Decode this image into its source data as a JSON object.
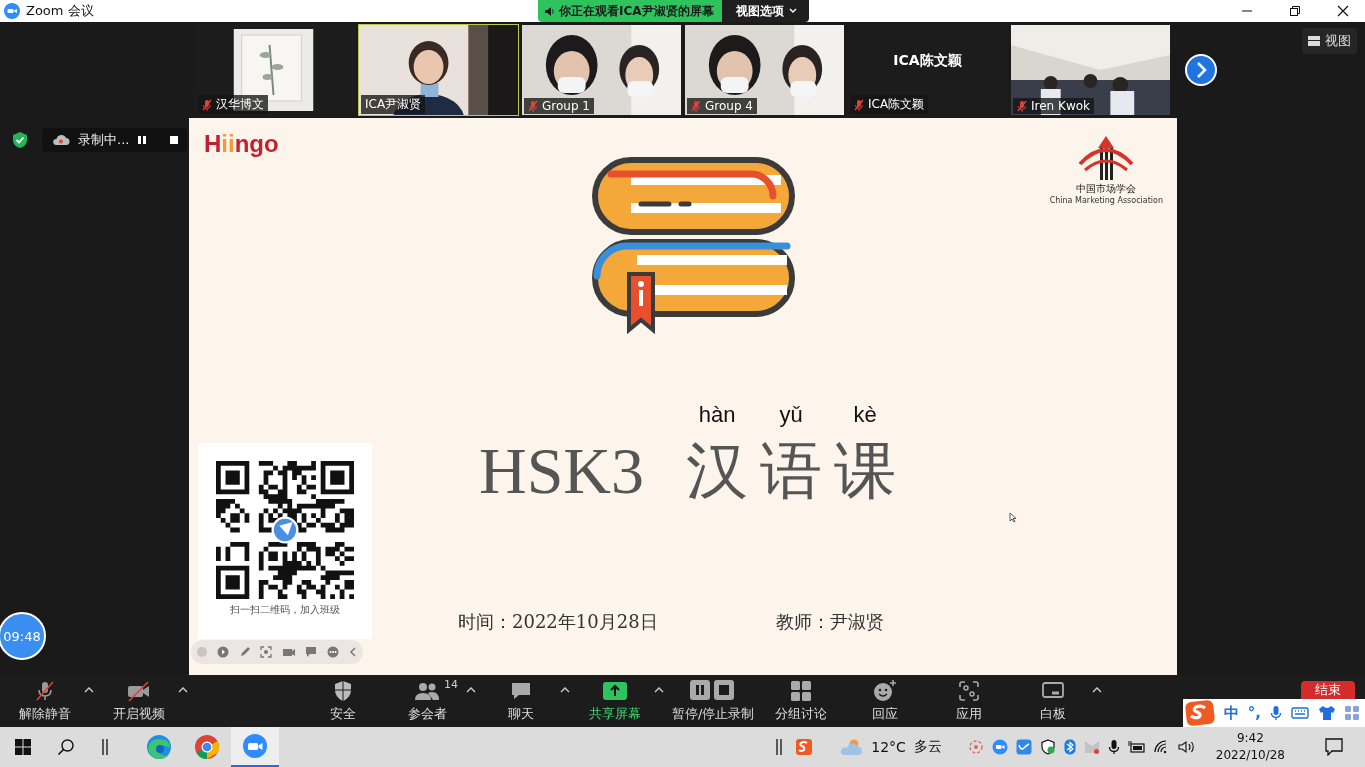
{
  "window": {
    "title": "Zoom 会议"
  },
  "banner": {
    "text": "你正在观看ICA尹淑贤的屏幕",
    "view_options": "视图选项"
  },
  "video_strip": {
    "tiles": [
      {
        "name": "汉华博文",
        "kind": "picture",
        "muted": true,
        "active": false
      },
      {
        "name": "ICA尹淑贤",
        "kind": "picture",
        "muted": false,
        "active": true
      },
      {
        "name": "Group 1",
        "kind": "picture",
        "muted": true,
        "active": false
      },
      {
        "name": "Group 4",
        "kind": "picture",
        "muted": true,
        "active": false
      },
      {
        "name": "ICA陈文颖",
        "card_name": "ICA陈文颖",
        "kind": "name_card",
        "muted": true,
        "active": false
      },
      {
        "name": "Iren Kwok",
        "kind": "picture",
        "muted": true,
        "active": false
      }
    ],
    "view_button": "视图"
  },
  "recording": {
    "label": "录制中..."
  },
  "timer": "09:48",
  "slide": {
    "logo": "Hiingo",
    "association": {
      "name": "中国市场学会",
      "english": "China Marketing Association"
    },
    "title": {
      "latin": "HSK3",
      "chars": [
        {
          "char": "汉",
          "pinyin": "hàn"
        },
        {
          "char": "语",
          "pinyin": "yǔ"
        },
        {
          "char": "课",
          "pinyin": "kè"
        }
      ]
    },
    "date": "时间：2022年10月28日",
    "teacher": "教师：尹淑贤",
    "qr_caption": "扫一扫二维码，加入班级"
  },
  "toolbar": {
    "items": [
      {
        "kind": "mic_off",
        "label": "解除静音",
        "caret": true,
        "highlight": false
      },
      {
        "kind": "video_off",
        "label": "开启视频",
        "caret": true,
        "highlight": false
      },
      {
        "kind": "shield",
        "label": "安全",
        "caret": false,
        "highlight": false
      },
      {
        "kind": "participants",
        "label": "参会者",
        "count": "14",
        "caret": true,
        "highlight": false
      },
      {
        "kind": "chat",
        "label": "聊天",
        "caret": true,
        "highlight": false
      },
      {
        "kind": "share",
        "label": "共享屏幕",
        "caret": true,
        "highlight": true
      },
      {
        "kind": "record",
        "label": "暂停/停止录制",
        "caret": false,
        "highlight": false
      },
      {
        "kind": "breakout",
        "label": "分组讨论",
        "caret": false,
        "highlight": false
      },
      {
        "kind": "reaction",
        "label": "回应",
        "caret": false,
        "highlight": false
      },
      {
        "kind": "apps",
        "label": "应用",
        "caret": false,
        "highlight": false
      },
      {
        "kind": "whiteboard",
        "label": "白板",
        "caret": true,
        "highlight": false
      }
    ],
    "end_button": "结束"
  },
  "ime_bar": {
    "mode": "中",
    "punctuation": "°,"
  },
  "taskbar": {
    "apps": [
      {
        "kind": "edge",
        "selected": false
      },
      {
        "kind": "chrome",
        "selected": false
      },
      {
        "kind": "zoom",
        "selected": true
      }
    ],
    "weather": {
      "temperature": "12°C",
      "condition": "多云"
    },
    "clock": {
      "time": "9:42",
      "date": "2022/10/28"
    }
  }
}
